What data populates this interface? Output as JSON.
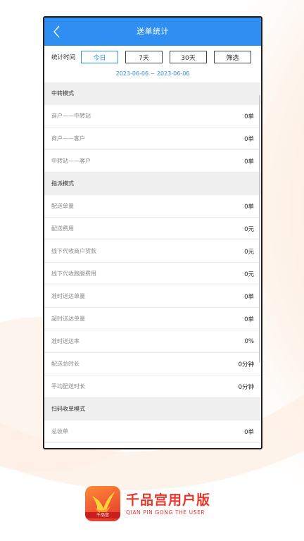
{
  "header": {
    "title": "送单统计"
  },
  "filter": {
    "label": "统计时间",
    "buttons": [
      "今日",
      "7天",
      "30天",
      "筛选"
    ],
    "active": "今日"
  },
  "date_range": "2023-06-06 ~ 2023-06-06",
  "sections": [
    {
      "title": "中转模式",
      "rows": [
        {
          "label": "商户——中转站",
          "value": "0单"
        },
        {
          "label": "商户——客户",
          "value": "0单"
        },
        {
          "label": "中转站——客户",
          "value": "0单"
        }
      ]
    },
    {
      "title": "指派模式",
      "rows": [
        {
          "label": "配送单量",
          "value": "0单"
        },
        {
          "label": "配送费用",
          "value": "0元"
        },
        {
          "label": "线下代收商户货款",
          "value": "0元"
        },
        {
          "label": "线下代收跑腿费用",
          "value": "0元"
        },
        {
          "label": "准时送达单量",
          "value": "0单"
        },
        {
          "label": "超时送达单量",
          "value": "0单"
        },
        {
          "label": "准时送达率",
          "value": "0%"
        },
        {
          "label": "配送总时长",
          "value": "0分钟"
        },
        {
          "label": "平均配送时长",
          "value": "0分钟"
        }
      ]
    },
    {
      "title": "扫码收单模式",
      "rows": [
        {
          "label": "总收单",
          "value": "0单"
        }
      ]
    }
  ],
  "branding": {
    "name": "千品宫用户版",
    "subtitle": "QIAN PIN GONG THE USER",
    "logo_text": "千品宫"
  },
  "colors": {
    "primary": "#2f8ef1",
    "brand": "#e8362a",
    "section_bg": "#efefef"
  },
  "icons": {
    "back": "chevron-left-icon",
    "logo": "bird-logo-icon"
  }
}
